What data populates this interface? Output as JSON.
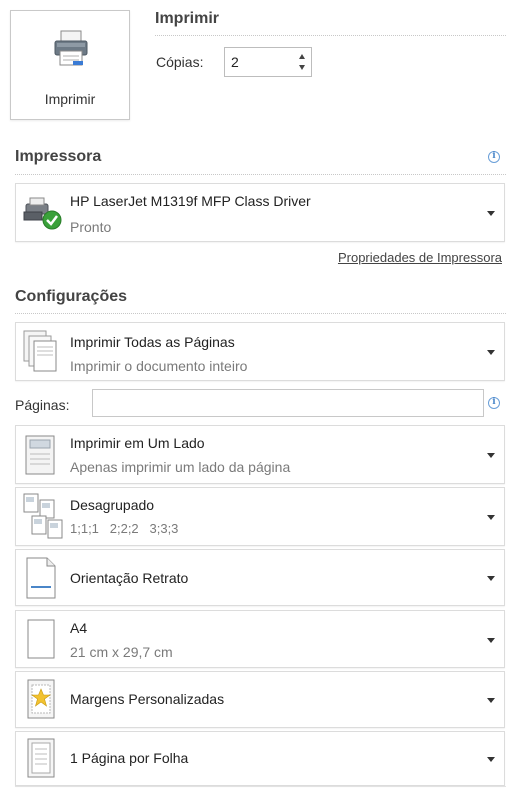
{
  "print_button": {
    "label": "Imprimir",
    "icon": "printer-icon"
  },
  "header": {
    "title": "Imprimir"
  },
  "copies": {
    "label": "Cópias:",
    "value": "2"
  },
  "printer_section": {
    "title": "Impressora",
    "printer_name": "HP LaserJet M1319f MFP Class Driver",
    "status": "Pronto",
    "properties_link": "Propriedades de Impressora",
    "status_color": "#3aa13a"
  },
  "settings_section": {
    "title": "Configurações",
    "pages_label": "Páginas:",
    "pages_value": "",
    "items": [
      {
        "main": "Imprimir Todas as Páginas",
        "sub": "Imprimir o documento inteiro",
        "icon": "all-pages-icon"
      },
      {
        "main": "Imprimir em Um Lado",
        "sub": "Apenas imprimir um lado da página",
        "icon": "one-side-icon"
      },
      {
        "main": "Desagrupado",
        "sub": "1;1;1   2;2;2   3;3;3",
        "icon": "uncollated-icon"
      },
      {
        "main": "Orientação Retrato",
        "sub": "",
        "icon": "portrait-icon"
      },
      {
        "main": "A4",
        "sub": "21 cm x 29,7 cm",
        "icon": "paper-size-icon"
      },
      {
        "main": "Margens Personalizadas",
        "sub": "",
        "icon": "margins-icon"
      },
      {
        "main": "1 Página por Folha",
        "sub": "",
        "icon": "pages-per-sheet-icon"
      }
    ]
  }
}
